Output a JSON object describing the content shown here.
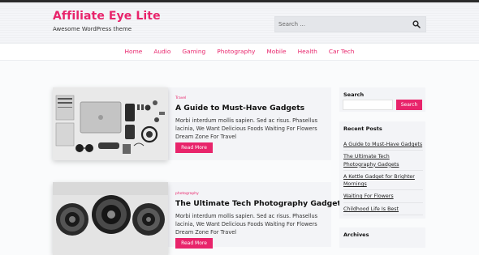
{
  "header": {
    "site_title": "Affiliate Eye Lite",
    "site_description": "Awesome WordPress theme",
    "search_placeholder": "Search ..."
  },
  "nav": {
    "items": [
      "Home",
      "Audio",
      "Gaming",
      "Photography",
      "Mobile",
      "Health",
      "Car Tech"
    ]
  },
  "posts": [
    {
      "category": "Travel",
      "title": "A Guide to Must-Have Gadgets",
      "excerpt": "Morbi interdum mollis sapien. Sed ac risus. Phasellus lacinia, We Want Delicious Foods Waiting For Flowers Dream Zone For Travel",
      "button": "Read More",
      "image_icon": "gadgets-flatlay-photo"
    },
    {
      "category": "photography",
      "title": "The Ultimate Tech Photography Gadgets",
      "excerpt": "Morbi interdum mollis sapien. Sed ac risus. Phasellus lacinia, We Want Delicious Foods Waiting For Flowers Dream Zone For Travel",
      "button": "Read More",
      "image_icon": "camera-lenses-photo"
    }
  ],
  "sidebar": {
    "search": {
      "title": "Search",
      "button": "Search"
    },
    "recent_posts": {
      "title": "Recent Posts",
      "items": [
        "A Guide to Must-Have Gadgets",
        "The Ultimate Tech Photography Gadgets",
        "A Kettle Gadget for Brighter Mornings",
        "Waiting For Flowers",
        "Childhood Life Is Best"
      ]
    },
    "archives": {
      "title": "Archives"
    }
  },
  "colors": {
    "accent": "#e8246b",
    "topbar": "#2b2b2b",
    "panel": "#f3f4f7"
  }
}
